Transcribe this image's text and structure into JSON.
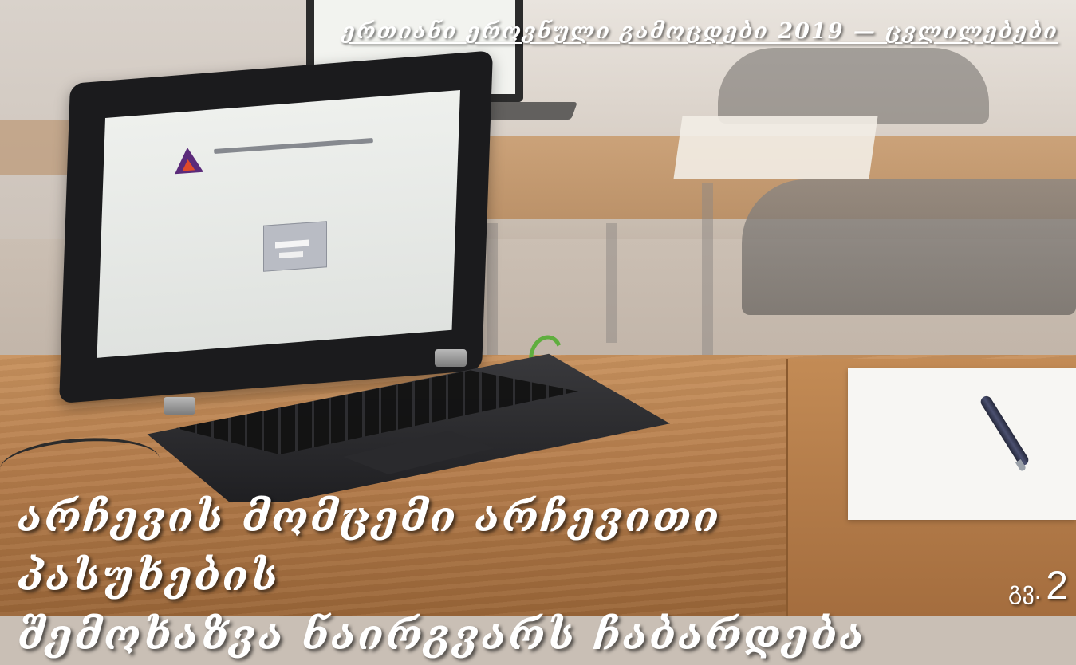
{
  "header": {
    "title": "ერთიანი ეროვნული გამოცდები 2019 — ცვლილებები"
  },
  "main_title": {
    "line1": "არჩევის მომცემი არჩევითი პასუხების",
    "line2": "შემოხაზვა ნაირგვარს ჩაბარდება"
  },
  "page_ref": {
    "abbr": "გვ.",
    "number": "2"
  }
}
